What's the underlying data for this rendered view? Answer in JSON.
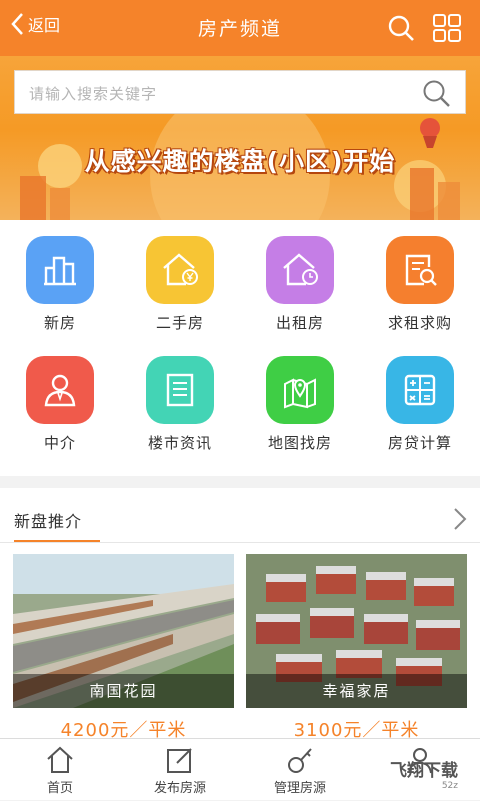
{
  "header": {
    "back_label": "返回",
    "title": "房产频道"
  },
  "search": {
    "placeholder": "请输入搜索关键字"
  },
  "banner": {
    "slogan": "从感兴趣的楼盘(小区)开始"
  },
  "categories": [
    {
      "label": "新房",
      "icon": "buildings-icon",
      "color": "#5aa2f5"
    },
    {
      "label": "二手房",
      "icon": "house-yen-icon",
      "color": "#f7c534"
    },
    {
      "label": "出租房",
      "icon": "house-clock-icon",
      "color": "#c57ee6"
    },
    {
      "label": "求租求购",
      "icon": "document-search-icon",
      "color": "#f57f2e"
    },
    {
      "label": "中介",
      "icon": "agent-icon",
      "color": "#f05a4b"
    },
    {
      "label": "楼市资讯",
      "icon": "news-icon",
      "color": "#43d4b5"
    },
    {
      "label": "地图找房",
      "icon": "map-pin-icon",
      "color": "#3fce45"
    },
    {
      "label": "房贷计算",
      "icon": "calculator-icon",
      "color": "#38b6e6"
    }
  ],
  "new_listings": {
    "title": "新盘推介",
    "items": [
      {
        "name": "南国花园",
        "price": "4200元／平米"
      },
      {
        "name": "幸福家居",
        "price": "3100元／平米"
      }
    ]
  },
  "bottom_nav": [
    {
      "label": "首页",
      "icon": "home-icon"
    },
    {
      "label": "发布房源",
      "icon": "edit-icon"
    },
    {
      "label": "管理房源",
      "icon": "key-icon"
    },
    {
      "label": "",
      "icon": "user-icon"
    }
  ],
  "watermark": {
    "text": "飞翔下载",
    "sub": "52z"
  },
  "colors": {
    "accent": "#f5832a"
  }
}
